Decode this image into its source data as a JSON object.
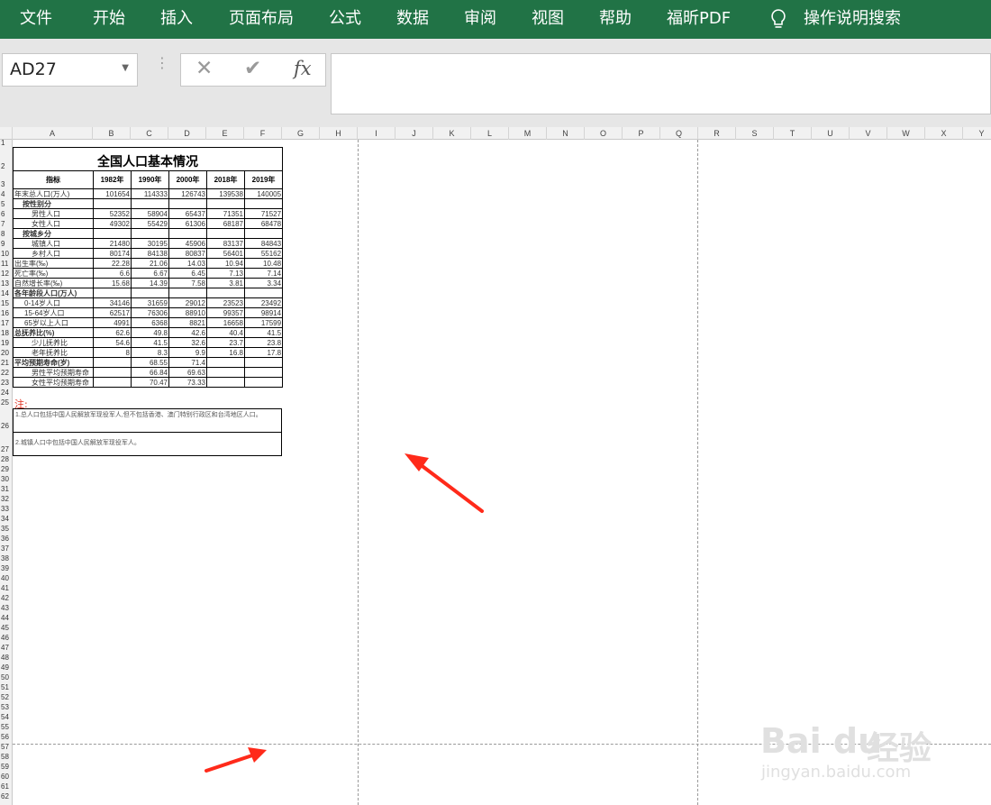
{
  "ribbon": {
    "tabs": [
      "文件",
      "开始",
      "插入",
      "页面布局",
      "公式",
      "数据",
      "审阅",
      "视图",
      "帮助",
      "福昕PDF"
    ],
    "tell_me": "操作说明搜索",
    "color": "#217346"
  },
  "formula_bar": {
    "name_box": "AD27",
    "cancel": "✕",
    "enter": "✔",
    "fx": "fx",
    "value": ""
  },
  "columns": [
    "A",
    "B",
    "C",
    "D",
    "E",
    "F",
    "G",
    "H",
    "I",
    "J",
    "K",
    "L",
    "M",
    "N",
    "O",
    "P",
    "Q",
    "R",
    "S",
    "T",
    "U",
    "V",
    "W",
    "X",
    "Y"
  ],
  "rows": [
    "1",
    "2",
    "3",
    "4",
    "5",
    "6",
    "7",
    "8",
    "9",
    "10",
    "11",
    "12",
    "13",
    "14",
    "15",
    "16",
    "17",
    "18",
    "19",
    "20",
    "21",
    "22",
    "23",
    "24",
    "25",
    "26",
    "27",
    "28",
    "29",
    "30",
    "31",
    "32",
    "33",
    "34",
    "35",
    "36",
    "37",
    "38",
    "39",
    "40",
    "41",
    "42",
    "43",
    "44",
    "45",
    "46",
    "47",
    "48",
    "49",
    "50",
    "51",
    "52",
    "53",
    "54",
    "55",
    "56",
    "57",
    "58",
    "59",
    "60",
    "61",
    "62"
  ],
  "sheet": {
    "title": "全国人口基本情况",
    "headers": [
      "指标",
      "1982年",
      "1990年",
      "2000年",
      "2018年",
      "2019年"
    ],
    "data_rows": [
      {
        "label": "年末总人口(万人)",
        "values": [
          "101654",
          "114333",
          "126743",
          "139538",
          "140005"
        ],
        "bold": false
      },
      {
        "label": "按性别分",
        "values": [
          "",
          "",
          "",
          "",
          ""
        ],
        "bold": true
      },
      {
        "label": "男性人口",
        "values": [
          "52352",
          "58904",
          "65437",
          "71351",
          "71527"
        ],
        "bold": false
      },
      {
        "label": "女性人口",
        "values": [
          "49302",
          "55429",
          "61306",
          "68187",
          "68478"
        ],
        "bold": false
      },
      {
        "label": "按城乡分",
        "values": [
          "",
          "",
          "",
          "",
          ""
        ],
        "bold": true
      },
      {
        "label": "城镇人口",
        "values": [
          "21480",
          "30195",
          "45906",
          "83137",
          "84843"
        ],
        "bold": false
      },
      {
        "label": "乡村人口",
        "values": [
          "80174",
          "84138",
          "80837",
          "56401",
          "55162"
        ],
        "bold": false
      },
      {
        "label": "出生率(‰)",
        "values": [
          "22.28",
          "21.06",
          "14.03",
          "10.94",
          "10.48"
        ],
        "bold": false
      },
      {
        "label": "死亡率(‰)",
        "values": [
          "6.6",
          "6.67",
          "6.45",
          "7.13",
          "7.14"
        ],
        "bold": false
      },
      {
        "label": "自然增长率(‰)",
        "values": [
          "15.68",
          "14.39",
          "7.58",
          "3.81",
          "3.34"
        ],
        "bold": false
      },
      {
        "label": "各年龄段人口(万人)",
        "values": [
          "",
          "",
          "",
          "",
          ""
        ],
        "bold": true
      },
      {
        "label": "0-14岁人口",
        "values": [
          "34146",
          "31659",
          "29012",
          "23523",
          "23492"
        ],
        "bold": false
      },
      {
        "label": "15-64岁人口",
        "values": [
          "62517",
          "76306",
          "88910",
          "99357",
          "98914"
        ],
        "bold": false
      },
      {
        "label": "65岁以上人口",
        "values": [
          "4991",
          "6368",
          "8821",
          "16658",
          "17599"
        ],
        "bold": false
      },
      {
        "label": "总抚养比(%)",
        "values": [
          "62.6",
          "49.8",
          "42.6",
          "40.4",
          "41.5"
        ],
        "bold": true
      },
      {
        "label": "少儿抚养比",
        "values": [
          "54.6",
          "41.5",
          "32.6",
          "23.7",
          "23.8"
        ],
        "bold": false
      },
      {
        "label": "老年抚养比",
        "values": [
          "8",
          "8.3",
          "9.9",
          "16.8",
          "17.8"
        ],
        "bold": false
      },
      {
        "label": "平均预期寿命(岁)",
        "values": [
          "",
          "68.55",
          "71.4",
          "",
          ""
        ],
        "bold": true
      },
      {
        "label": "男性平均预期寿命",
        "values": [
          "",
          "66.84",
          "69.63",
          "",
          ""
        ],
        "bold": false
      },
      {
        "label": "女性平均预期寿命",
        "values": [
          "",
          "70.47",
          "73.33",
          "",
          ""
        ],
        "bold": false
      }
    ],
    "note_label": "注:",
    "notes": [
      "1.总人口包括中国人民解放军现役军人,但不包括香港、澳门特别行政区和台湾地区人口。",
      "2.城镇人口中包括中国人民解放军现役军人。"
    ]
  },
  "watermark": {
    "brand": "Bai du",
    "cn": "经验",
    "url": "jingyan.baidu.com"
  },
  "annotation_color": "#ff2a1a"
}
